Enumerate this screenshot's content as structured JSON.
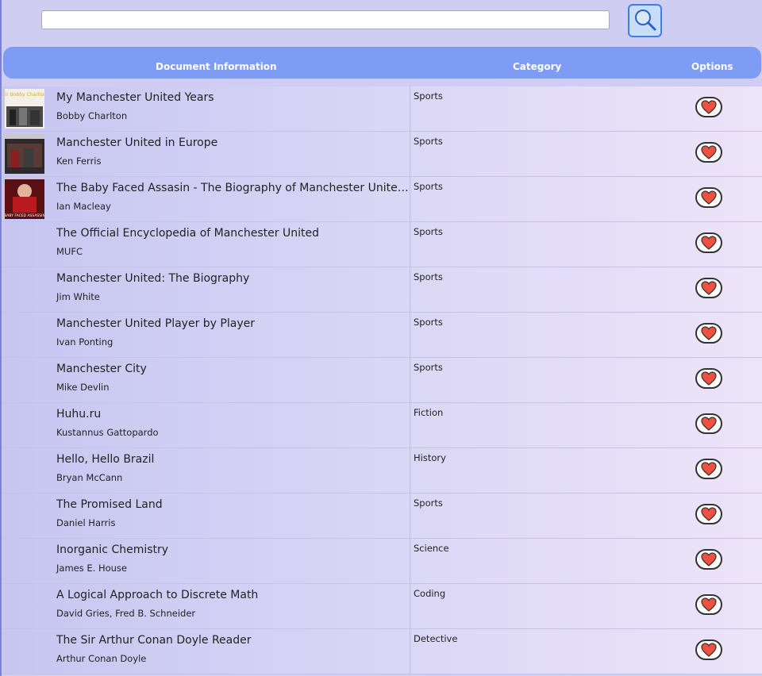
{
  "search": {
    "placeholder": "",
    "value": ""
  },
  "icons": {
    "search": "search-icon",
    "favorite": "heart-icon"
  },
  "colors": {
    "header_bg": "#7e9cf4",
    "heart": "#f0503f",
    "search_border": "#3f7fe6"
  },
  "table": {
    "headers": {
      "info": "Document Information",
      "category": "Category",
      "options": "Options"
    },
    "rows": [
      {
        "title": "My Manchester United Years",
        "author": "Bobby Charlton",
        "category": "Sports",
        "cover": "book-cover",
        "cover_text": "Sir Bobby Charlton"
      },
      {
        "title": "Manchester United in Europe",
        "author": "Ken Ferris",
        "category": "Sports",
        "cover": "book-cover"
      },
      {
        "title": "The Baby Faced Assasin - The Biography of Manchester United's Ol...",
        "author": "Ian Macleay",
        "category": "Sports",
        "cover": "book-cover",
        "cover_text": "BABY FACED ASSASSIN"
      },
      {
        "title": "The Official Encyclopedia of Manchester United",
        "author": "MUFC",
        "category": "Sports"
      },
      {
        "title": "Manchester United: The Biography",
        "author": "Jim White",
        "category": "Sports"
      },
      {
        "title": "Manchester United Player by Player",
        "author": "Ivan Ponting",
        "category": "Sports"
      },
      {
        "title": "Manchester City",
        "author": "Mike Devlin",
        "category": "Sports"
      },
      {
        "title": "Huhu.ru",
        "author": "Kustannus Gattopardo",
        "category": "Fiction"
      },
      {
        "title": "Hello, Hello Brazil",
        "author": "Bryan McCann",
        "category": "History"
      },
      {
        "title": "The Promised Land",
        "author": "Daniel Harris",
        "category": "Sports"
      },
      {
        "title": "Inorganic Chemistry",
        "author": "James E. House",
        "category": "Science"
      },
      {
        "title": "A Logical Approach to Discrete Math",
        "author": "David Gries, Fred B. Schneider",
        "category": "Coding"
      },
      {
        "title": "The Sir Arthur Conan Doyle Reader",
        "author": "Arthur Conan Doyle",
        "category": "Detective"
      }
    ]
  }
}
